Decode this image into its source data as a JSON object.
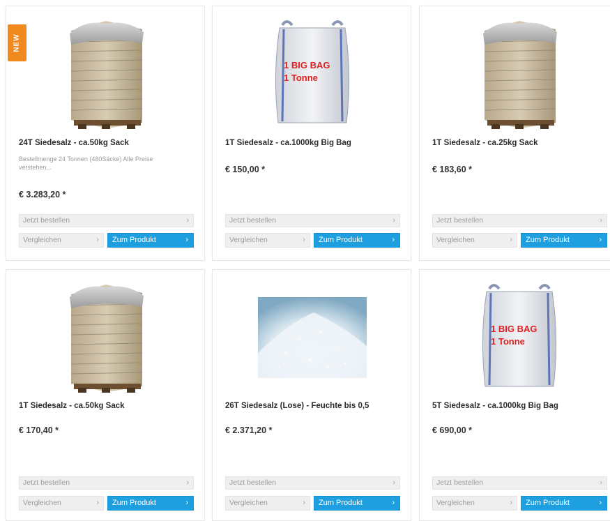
{
  "badge": {
    "new_label": "NEW"
  },
  "products": [
    {
      "title": "24T Siedesalz - ca.50kg Sack",
      "description": "Bestellmenge 24 Tonnen (480Säcke) Alle Preise verstehen...",
      "price": "€ 3.283,20 *",
      "image": "pallet-of-sacks",
      "bag_label_line1": "",
      "bag_label_line2": "",
      "order_label": "Jetzt bestellen",
      "compare_label": "Vergleichen",
      "product_label": "Zum Produkt"
    },
    {
      "title": "1T Siedesalz - ca.1000kg Big Bag",
      "description": "",
      "price": "€ 150,00 *",
      "image": "big-bag",
      "bag_label_line1": "1 BIG BAG",
      "bag_label_line2": "1 Tonne",
      "order_label": "Jetzt bestellen",
      "compare_label": "Vergleichen",
      "product_label": "Zum Produkt"
    },
    {
      "title": "1T Siedesalz - ca.25kg Sack",
      "description": "",
      "price": "€ 183,60 *",
      "image": "pallet-of-sacks",
      "bag_label_line1": "",
      "bag_label_line2": "",
      "order_label": "Jetzt bestellen",
      "compare_label": "Vergleichen",
      "product_label": "Zum Produkt"
    },
    {
      "title": "1T Siedesalz - ca.50kg Sack",
      "description": "",
      "price": "€ 170,40 *",
      "image": "pallet-of-sacks",
      "bag_label_line1": "",
      "bag_label_line2": "",
      "order_label": "Jetzt bestellen",
      "compare_label": "Vergleichen",
      "product_label": "Zum Produkt"
    },
    {
      "title": "26T Siedesalz (Lose) - Feuchte bis 0,5",
      "description": "",
      "price": "€ 2.371,20 *",
      "image": "loose-salt",
      "bag_label_line1": "",
      "bag_label_line2": "",
      "order_label": "Jetzt bestellen",
      "compare_label": "Vergleichen",
      "product_label": "Zum Produkt"
    },
    {
      "title": "5T Siedesalz - ca.1000kg Big Bag",
      "description": "",
      "price": "€ 690,00 *",
      "image": "big-bag",
      "bag_label_line1": "1 BIG BAG",
      "bag_label_line2": "1 Tonne",
      "order_label": "Jetzt bestellen",
      "compare_label": "Vergleichen",
      "product_label": "Zum Produkt"
    }
  ],
  "colors": {
    "accent": "#1e9fe0",
    "badge": "#f08a1e",
    "bag_label": "#e02020"
  }
}
